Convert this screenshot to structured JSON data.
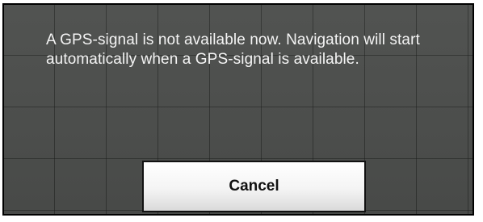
{
  "dialog": {
    "message": "A GPS-signal is not available now. Navigation will start automatically when a GPS-signal is available.",
    "cancel_label": "Cancel"
  },
  "colors": {
    "background": "#4e504e",
    "grid": "#1e201e",
    "text": "#f4f4f4",
    "button_top": "#ffffff",
    "button_bottom": "#dadada",
    "border": "#000000"
  }
}
